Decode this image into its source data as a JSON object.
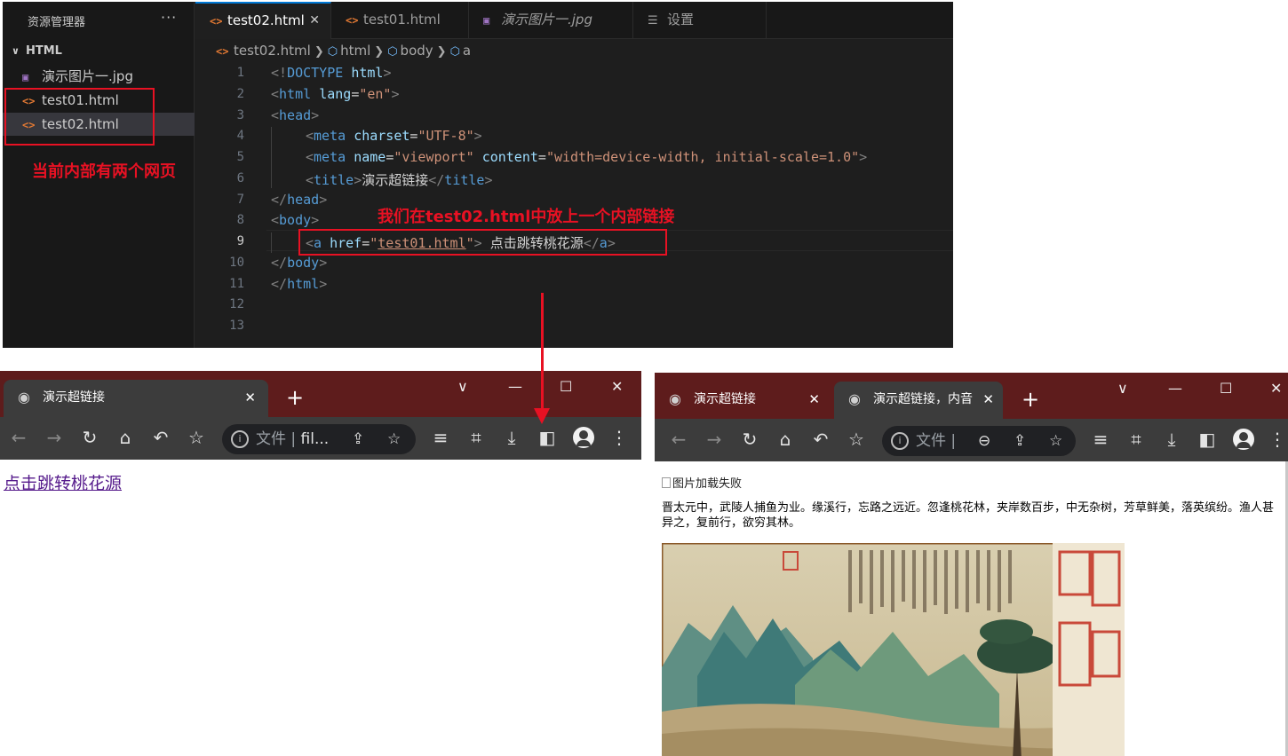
{
  "vscode": {
    "explorer": {
      "title": "资源管理器",
      "more": "···",
      "folder": "HTML",
      "files": [
        {
          "name": "演示图片一.jpg",
          "icon": "image-file-icon"
        },
        {
          "name": "test01.html",
          "icon": "html-file-icon"
        },
        {
          "name": "test02.html",
          "icon": "html-file-icon"
        }
      ]
    },
    "tabs": [
      {
        "label": "test02.html",
        "active": true,
        "close": "✕"
      },
      {
        "label": "test01.html",
        "active": false
      },
      {
        "label": "演示图片一.jpg",
        "active": false
      },
      {
        "label": "设置",
        "active": false
      }
    ],
    "breadcrumb": [
      "test02.html",
      "html",
      "body",
      "a"
    ],
    "line_numbers": [
      "1",
      "2",
      "3",
      "4",
      "5",
      "6",
      "7",
      "8",
      "9",
      "10",
      "11",
      "12",
      "13"
    ],
    "active_line": "9",
    "code": {
      "l1": {
        "open": "<!",
        "kw": "DOCTYPE",
        "sp": " ",
        "val": "html",
        "close": ">"
      },
      "l2": {
        "open": "<",
        "tag": "html",
        "sp": " ",
        "attr": "lang",
        "eq": "=",
        "val": "\"en\"",
        "close": ">"
      },
      "l3": {
        "open": "<",
        "tag": "head",
        "close": ">"
      },
      "l4": {
        "open": "<",
        "tag": "meta",
        "sp": " ",
        "attr": "charset",
        "eq": "=",
        "val": "\"UTF-8\"",
        "close": ">"
      },
      "l5": {
        "open": "<",
        "tag": "meta",
        "sp": " ",
        "attr1": "name",
        "eq1": "=",
        "val1": "\"viewport\"",
        "sp2": " ",
        "attr2": "content",
        "eq2": "=",
        "val2": "\"width=device-width, initial-scale=1.0\"",
        "close": ">"
      },
      "l6": {
        "open": "<",
        "tag": "title",
        "close": ">",
        "text": "演示超链接",
        "end_open": "</",
        "end_tag": "title",
        "end_close": ">"
      },
      "l7": {
        "open": "</",
        "tag": "head",
        "close": ">"
      },
      "l8": {
        "open": "<",
        "tag": "body",
        "close": ">"
      },
      "l9": {
        "open": "<",
        "tag": "a",
        "sp": " ",
        "attr": "href",
        "eq": "=",
        "q1": "\"",
        "val": "test01.html",
        "q2": "\"",
        "close": ">",
        "text": " 点击跳转桃花源",
        "end_open": "</",
        "end_tag": "a",
        "end_close": ">"
      },
      "l10": {
        "open": "</",
        "tag": "body",
        "close": ">"
      },
      "l11": {
        "open": "</",
        "tag": "html",
        "close": ">"
      }
    }
  },
  "annotations": {
    "two_pages": "当前内部有两个网页",
    "internal_link": "我们在test02.html中放上一个内部链接"
  },
  "browser_left": {
    "tab_title": "演示超链接",
    "tab_close": "✕",
    "new_tab": "+",
    "address_prefix": "文件",
    "address_sep": "|",
    "address_text": "fil...",
    "page_link": "点击跳转桃花源"
  },
  "browser_right": {
    "tabs": [
      {
        "title": "演示超链接",
        "close": "✕"
      },
      {
        "title": "演示超链接，内音",
        "close": "✕"
      }
    ],
    "new_tab": "+",
    "address_prefix": "文件",
    "address_sep": "|",
    "broken_image_alt": "图片加载失败",
    "paragraph": "晋太元中，武陵人捕鱼为业。缘溪行，忘路之远近。忽逢桃花林，夹岸数百步，中无杂树，芳草鲜美，落英缤纷。渔人甚异之，复前行，欲穷其林。"
  },
  "colors": {
    "accent": "#0078d4",
    "annotation_red": "#e81123",
    "browser_frame": "#5e1c1c",
    "link_visited": "#551a8b"
  }
}
